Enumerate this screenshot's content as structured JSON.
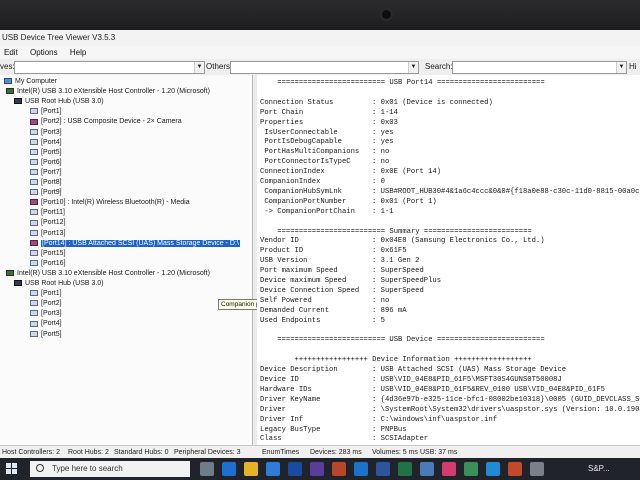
{
  "window": {
    "title": "USB Device Tree Viewer V3.5.3",
    "menu": [
      "Edit",
      "Options",
      "Help"
    ],
    "filters": {
      "left_label": "ves:",
      "left_value": "",
      "others_label": "Others:",
      "others_value": "",
      "search_label": "Search:",
      "search_value": "",
      "right_hint": "Hi"
    }
  },
  "tree": [
    {
      "label": "My Computer",
      "icon": "computer-icon"
    },
    {
      "label": "Intel(R) USB 3.10 eXtensible Host Controller - 1.20 (Microsoft)",
      "icon": "controller-icon"
    },
    {
      "label": "USB Root Hub (USB 3.0)",
      "icon": "hub-icon"
    },
    {
      "label": "[Port1]",
      "icon": "port-icon"
    },
    {
      "label": "[Port2] : USB Composite Device - 2× Camera",
      "icon": "device-icon"
    },
    {
      "label": "[Port3]",
      "icon": "port-icon"
    },
    {
      "label": "[Port4]",
      "icon": "port-icon"
    },
    {
      "label": "[Port5]",
      "icon": "port-icon"
    },
    {
      "label": "[Port6]",
      "icon": "port-icon"
    },
    {
      "label": "[Port7]",
      "icon": "port-icon"
    },
    {
      "label": "[Port8]",
      "icon": "port-icon"
    },
    {
      "label": "[Port9]",
      "icon": "port-icon"
    },
    {
      "label": "[Port10] : Intel(R) Wireless Bluetooth(R) - Media",
      "icon": "device-icon"
    },
    {
      "label": "[Port11]",
      "icon": "port-icon"
    },
    {
      "label": "[Port12]",
      "icon": "port-icon"
    },
    {
      "label": "[Port13]",
      "icon": "port-icon"
    },
    {
      "label": "[Port14] : USB Attached SCSI (UAS) Mass Storage Device - D:\\",
      "icon": "device-icon",
      "selected": true
    },
    {
      "label": "[Port15]",
      "icon": "port-icon"
    },
    {
      "label": "[Port16]",
      "icon": "port-icon"
    },
    {
      "label": "Intel(R) USB 3.10 eXtensible Host Controller - 1.20 (Microsoft)",
      "icon": "controller-icon"
    },
    {
      "label": "USB Root Hub (USB 3.0)",
      "icon": "hub-icon"
    },
    {
      "label": "[Port1]",
      "icon": "port-icon"
    },
    {
      "label": "[Port2]",
      "icon": "port-icon"
    },
    {
      "label": "[Port3]",
      "icon": "port-icon"
    },
    {
      "label": "[Port4]",
      "icon": "port-icon"
    },
    {
      "label": "[Port5]",
      "icon": "port-icon"
    }
  ],
  "tooltip": "Companion port: 1-1",
  "details": [
    {
      "text": "    ========================= USB Port14 ========================="
    },
    {
      "text": ""
    },
    {
      "key": "Connection Status",
      "val": ": 0x01 (Device is connected)"
    },
    {
      "key": "Port Chain",
      "val": ": 1-14"
    },
    {
      "key": "Properties",
      "val": ": 0x03"
    },
    {
      "key": " IsUserConnectable",
      "val": ": yes"
    },
    {
      "key": " PortIsDebugCapable",
      "val": ": yes"
    },
    {
      "key": " PortHasMultiCompanions",
      "val": ": no"
    },
    {
      "key": " PortConnectorIsTypeC",
      "val": ": no"
    },
    {
      "key": "ConnectionIndex",
      "val": ": 0x0E (Port 14)"
    },
    {
      "key": "CompanionIndex",
      "val": ": 0"
    },
    {
      "key": " CompanionHubSymLnk",
      "val": ": USB#ROOT_HUB30#4&1a6c4ccc&0&0#{f18a0e88-c30c-11d0-8815-00a0c"
    },
    {
      "key": " CompanionPortNumber",
      "val": ": 0x01 (Port 1)"
    },
    {
      "key": " -> CompanionPortChain",
      "val": ": 1-1"
    },
    {
      "text": ""
    },
    {
      "text": "    ========================= Summary ========================="
    },
    {
      "key": "Vendor ID",
      "val": ": 0x04E8 (Samsung Electronics Co., Ltd.)"
    },
    {
      "key": "Product ID",
      "val": ": 0x61F5"
    },
    {
      "key": "USB Version",
      "val": ": 3.1 Gen 2"
    },
    {
      "key": "Port maximum Speed",
      "val": ": SuperSpeed"
    },
    {
      "key": "Device maximum Speed",
      "val": ": SuperSpeedPlus"
    },
    {
      "key": "Device Connection Speed",
      "val": ": SuperSpeed"
    },
    {
      "key": "Self Powered",
      "val": ": no"
    },
    {
      "key": "Demanded Current",
      "val": ": 896 mA"
    },
    {
      "key": "Used Endpoints",
      "val": ": 5"
    },
    {
      "text": ""
    },
    {
      "text": "    ========================= USB Device ========================="
    },
    {
      "text": ""
    },
    {
      "text": "        +++++++++++++++++ Device Information ++++++++++++++++++"
    },
    {
      "key": "Device Description",
      "val": ": USB Attached SCSI (UAS) Mass Storage Device"
    },
    {
      "key": "Device ID",
      "val": ": USB\\VID_04E8&PID_61F5\\MSFT30S4GUNS0T50008J"
    },
    {
      "key": "Hardware IDs",
      "val": ": USB\\VID_04E8&PID_61F5&REV_0100 USB\\VID_04E8&PID_61F5"
    },
    {
      "key": "Driver KeyName",
      "val": ": {4d36e97b-e325-11ce-bfc1-08002be10318}\\0005 (GUID_DEVCLASS_SC"
    },
    {
      "key": "Driver",
      "val": ": \\SystemRoot\\System32\\drivers\\uaspstor.sys (Version: 10.0.1904"
    },
    {
      "key": "Driver Inf",
      "val": ": C:\\windows\\inf\\uaspstor.inf"
    },
    {
      "key": "Legacy BusType",
      "val": ": PNPBus"
    },
    {
      "key": "Class",
      "val": ": SCSIAdapter"
    }
  ],
  "status": {
    "host_controllers": "Host Controllers: 2",
    "root_hubs": "Root Hubs: 2",
    "standard_hubs": "Standard Hubs: 0",
    "peripheral_devices": "Peripheral Devices: 3",
    "enum_times": "EnumTimes",
    "devices": "Devices: 283 ms",
    "volumes": "Volumes: 5 ms",
    "usb": "USB: 37 ms"
  },
  "taskbar": {
    "search_placeholder": "Type here to search",
    "tray_text": "S&P..."
  }
}
